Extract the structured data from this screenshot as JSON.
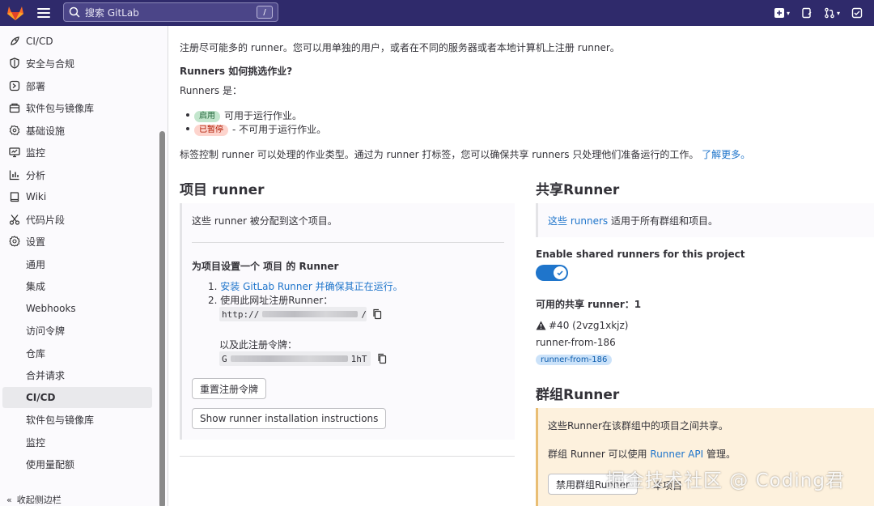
{
  "topbar": {
    "search_placeholder": "搜索 GitLab",
    "search_shortcut": "/"
  },
  "sidebar": {
    "items": [
      {
        "label": "CI/CD",
        "icon": "rocket-icon"
      },
      {
        "label": "安全与合规",
        "icon": "shield-icon"
      },
      {
        "label": "部署",
        "icon": "deployments-icon"
      },
      {
        "label": "软件包与镜像库",
        "icon": "package-icon"
      },
      {
        "label": "基础设施",
        "icon": "cloud-gear-icon"
      },
      {
        "label": "监控",
        "icon": "monitor-icon"
      },
      {
        "label": "分析",
        "icon": "chart-icon"
      },
      {
        "label": "Wiki",
        "icon": "book-icon"
      },
      {
        "label": "代码片段",
        "icon": "scissors-icon"
      },
      {
        "label": "设置",
        "icon": "settings-icon"
      }
    ],
    "sub_items": [
      "通用",
      "集成",
      "Webhooks",
      "访问令牌",
      "仓库",
      "合并请求",
      "CI/CD",
      "软件包与镜像库",
      "监控",
      "使用量配额"
    ],
    "active_sub": "CI/CD",
    "collapse_label": "收起侧边栏"
  },
  "intro": {
    "line1": "注册尽可能多的 runner。您可以用单独的用户，或者在不同的服务器或者本地计算机上注册 runner。",
    "how_title": "Runners 如何挑选作业?",
    "runners_are": "Runners 是：",
    "enabled_badge": "启用",
    "enabled_text": "可用于运行作业。",
    "paused_badge": "已暂停",
    "paused_text": "- 不可用于运行作业。",
    "tags_text": "标签控制 runner 可以处理的作业类型。通过为 runner 打标签，您可以确保共享 runners 只处理他们准备运行的工作。",
    "learn_more": "了解更多。"
  },
  "project_runner": {
    "title": "项目 runner",
    "assigned_text": "这些 runner 被分配到这个项目。",
    "setup_title": "为项目设置一个 项目 的 Runner",
    "step1_num": "1.",
    "step1_link": "安装 GitLab Runner 并确保其正在运行。",
    "step2": "2. 使用此网址注册Runner：",
    "url_prefix": "http://",
    "url_suffix": "/",
    "token_label": "以及此注册令牌：",
    "token_prefix": "G",
    "token_suffix": "1hT",
    "reset_button": "重置注册令牌",
    "install_button": "Show runner installation instructions"
  },
  "shared_runner": {
    "title": "共享Runner",
    "info_link": "这些 runners",
    "info_text": " 适用于所有群组和项目。",
    "enable_label": "Enable shared runners for this project",
    "enabled": true,
    "available_label": "可用的共享 runner：1",
    "runner_id": "#40 (2vzg1xkjz)",
    "runner_name": "runner-from-186",
    "runner_tag": "runner-from-186"
  },
  "group_runner": {
    "title": "群组Runner",
    "info_text": "这些Runner在该群组中的项目之间共享。",
    "manage_prefix": "群组 Runner 可以使用 ",
    "manage_link": "Runner API",
    "manage_suffix": " 管理。",
    "disable_button": "禁用群组Runner",
    "trailing_text": "本项目"
  },
  "watermark": "掘金技术社区 @ Coding君",
  "colors": {
    "topbar_bg": "#2f2a6b",
    "link": "#1f75cb",
    "toggle": "#1f75cb"
  }
}
